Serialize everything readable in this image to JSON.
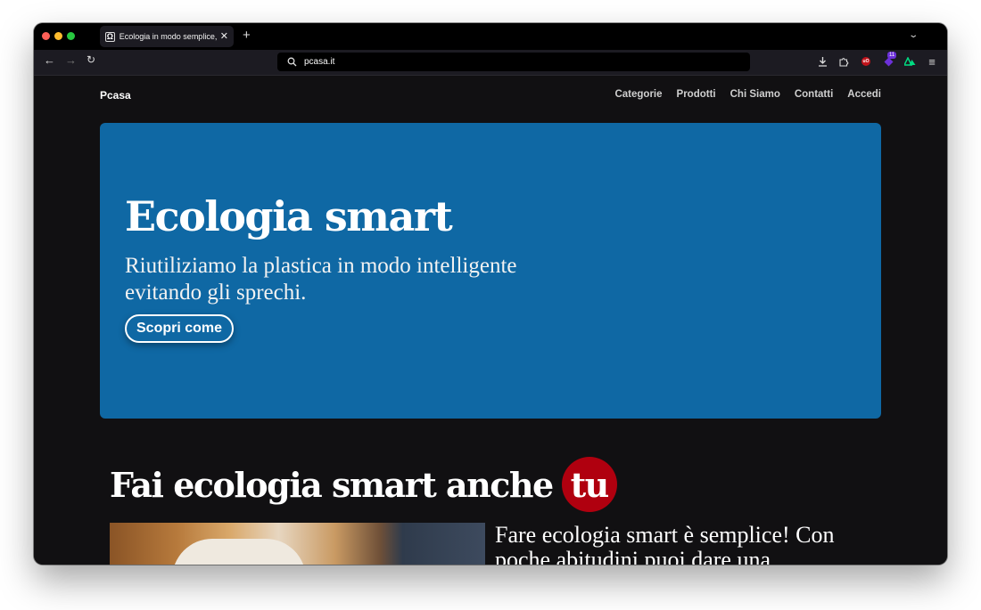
{
  "browser": {
    "tab_title": "Ecologia in modo semplice, prodotti smart",
    "tab_favicon": "Ω",
    "tab_close": "✕",
    "new_tab": "+",
    "tab_list": "⌄",
    "url": "pcasa.it",
    "back": "←",
    "forward": "→",
    "reload": "↻",
    "menu": "≡",
    "ext_badge": "11",
    "ext_red_label": "uO"
  },
  "site": {
    "brand": "Pcasa",
    "nav": [
      "Categorie",
      "Prodotti",
      "Chi Siamo",
      "Contatti",
      "Accedi"
    ]
  },
  "hero": {
    "title": "Ecologia smart",
    "subtitle": "Riutiliziamo la plastica in modo intelligente evitando gli sprechi.",
    "cta": "Scopri come",
    "bg_color": "#0f68a4"
  },
  "section": {
    "title": "Fai ecologia smart anche",
    "highlight": "tu",
    "highlight_color": "#b0000f",
    "body": "Fare ecologia smart è semplice! Con poche abitudini puoi dare una"
  }
}
